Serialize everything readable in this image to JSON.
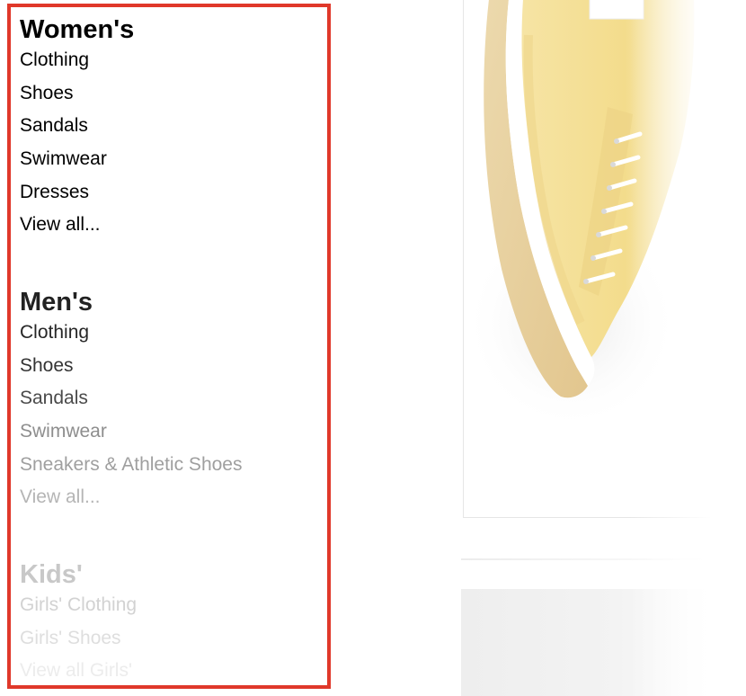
{
  "nav": {
    "women": {
      "title": "Women's",
      "links": [
        "Clothing",
        "Shoes",
        "Sandals",
        "Swimwear",
        "Dresses",
        "View all..."
      ]
    },
    "mens": {
      "title": "Men's",
      "links": [
        "Clothing",
        "Shoes",
        "Sandals",
        "Swimwear",
        "Sneakers & Athletic Shoes",
        "View all..."
      ]
    },
    "kids": {
      "title": "Kids'",
      "links": [
        "Girls' Clothing",
        "Girls' Shoes",
        "View all Girls'"
      ]
    }
  },
  "colors": {
    "highlight_border": "#e0382a",
    "shoe_canvas": "#f3dc8c",
    "shoe_sole": "#e2c68e"
  },
  "icons": {
    "product_image": "shoe-image"
  }
}
